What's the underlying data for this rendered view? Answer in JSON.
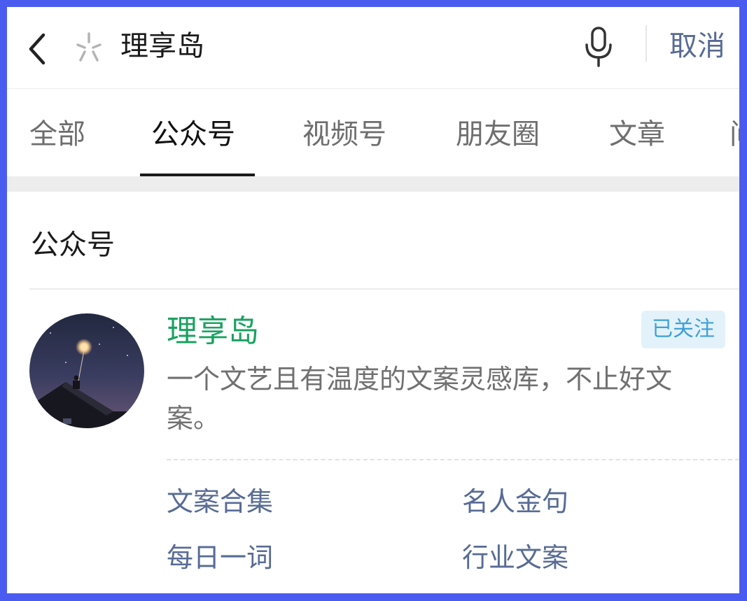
{
  "search": {
    "query": "理享岛",
    "cancel_label": "取消"
  },
  "tabs": [
    {
      "label": "全部",
      "active": false
    },
    {
      "label": "公众号",
      "active": true
    },
    {
      "label": "视频号",
      "active": false
    },
    {
      "label": "朋友圈",
      "active": false
    },
    {
      "label": "文章",
      "active": false
    },
    {
      "label": "问",
      "active": false
    }
  ],
  "section": {
    "title": "公众号"
  },
  "account": {
    "name": "理享岛",
    "follow_status": "已关注",
    "description": "一个文艺且有温度的文案灵感库，不止好文案。",
    "menu": [
      {
        "label": "文案合集"
      },
      {
        "label": "名人金句"
      },
      {
        "label": "每日一词"
      },
      {
        "label": "行业文案"
      }
    ]
  },
  "colors": {
    "frame_border": "#4a5cf0",
    "account_name": "#1aa260",
    "link": "#576b95",
    "badge_bg": "#e3f2fa",
    "badge_text": "#3fa0d6"
  },
  "icons": {
    "back": "back-arrow-icon",
    "sparkle": "sparkle-icon",
    "mic": "microphone-icon"
  }
}
